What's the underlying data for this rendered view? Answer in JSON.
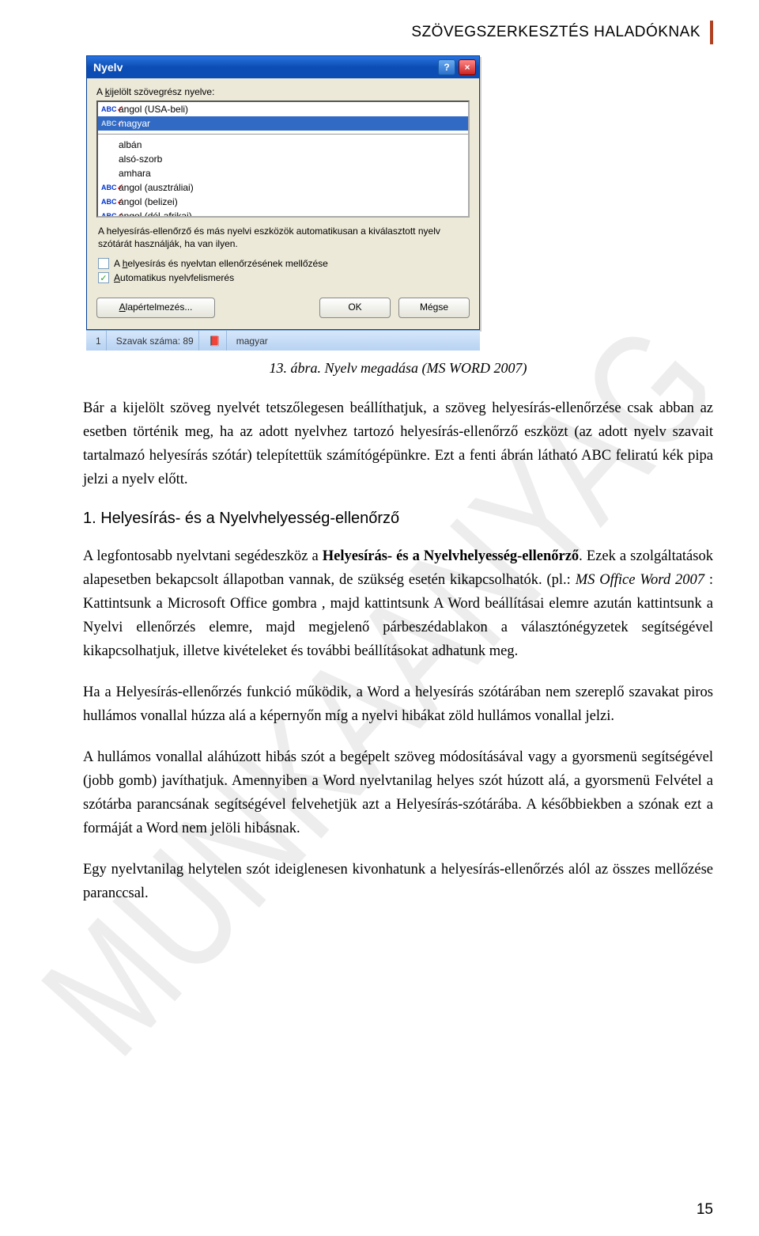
{
  "header": {
    "title": "SZÖVEGSZERKESZTÉS HALADÓKNAK"
  },
  "watermark": "MUNKAANYAG",
  "dialog": {
    "title": "Nyelv",
    "help_btn": "?",
    "close_btn": "×",
    "label_selected": "A kijelölt szövegrész nyelve:",
    "langs": {
      "l0": "angol (USA-beli)",
      "l1": "magyar",
      "l2": "albán",
      "l3": "alsó-szorb",
      "l4": "amhara",
      "l5": "angol (ausztráliai)",
      "l6": "angol (belizei)",
      "l7": "angol (dél-afrikai)"
    },
    "helptext": "A helyesírás-ellenőrző és más nyelvi eszközök automatikusan a kiválasztott nyelv szótárát használják, ha van ilyen.",
    "chk1": "A helyesírás és nyelvtan ellenőrzésének mellőzése",
    "chk2": "Automatikus nyelvfelismerés",
    "btn_default": "Alapértelmezés...",
    "btn_ok": "OK",
    "btn_cancel": "Mégse"
  },
  "status": {
    "page": "1",
    "words_label": "Szavak száma: 89",
    "lang": "magyar"
  },
  "caption": "13. ábra. Nyelv megadása (MS WORD 2007)",
  "paras": {
    "p1": "Bár a kijelölt szöveg nyelvét tetszőlegesen beállíthatjuk, a szöveg helyesírás-ellenőrzése csak abban az esetben történik meg, ha az adott nyelvhez tartozó helyesírás-ellenőrző eszközt (az adott nyelv szavait tartalmazó helyesírás szótár) telepítettük számítógépünkre. Ezt a fenti ábrán látható ABC feliratú kék pipa jelzi a nyelv előtt.",
    "h3": "1. Helyesírás- és a Nyelvhelyesség-ellenőrző",
    "p2a": "A legfontosabb nyelvtani segédeszköz a ",
    "p2b": "Helyesírás- és a Nyelvhelyesség-ellenőrző",
    "p2c": ". Ezek a szolgáltatások alapesetben bekapcsolt állapotban vannak, de szükség esetén kikapcsolhatók. (pl.: ",
    "p2d": "MS Office Word 2007",
    "p2e": " : Kattintsunk a Microsoft Office gombra , majd kattintsunk A Word beállításai elemre azután kattintsunk a Nyelvi ellenőrzés elemre, majd megjelenő párbeszédablakon a választónégyzetek segítségével kikapcsolhatjuk, illetve kivételeket és további beállításokat adhatunk meg.",
    "p3": "Ha a Helyesírás-ellenőrzés funkció működik, a Word a helyesírás szótárában nem szereplő szavakat piros hullámos vonallal húzza alá a képernyőn míg a nyelvi hibákat zöld hullámos vonallal jelzi.",
    "p4": "A hullámos vonallal aláhúzott hibás szót a begépelt szöveg módosításával vagy a gyorsmenü segítségével (jobb gomb) javíthatjuk. Amennyiben a Word nyelvtanilag helyes szót húzott alá, a gyorsmenü Felvétel a szótárba parancsának segítségével felvehetjük azt a Helyesírás-szótárába. A későbbiekben a szónak ezt a formáját a Word nem jelöli hibásnak.",
    "p5": "Egy nyelvtanilag helytelen szót ideiglenesen kivonhatunk a helyesírás-ellenőrzés alól az összes mellőzése paranccsal."
  },
  "pageno": "15"
}
